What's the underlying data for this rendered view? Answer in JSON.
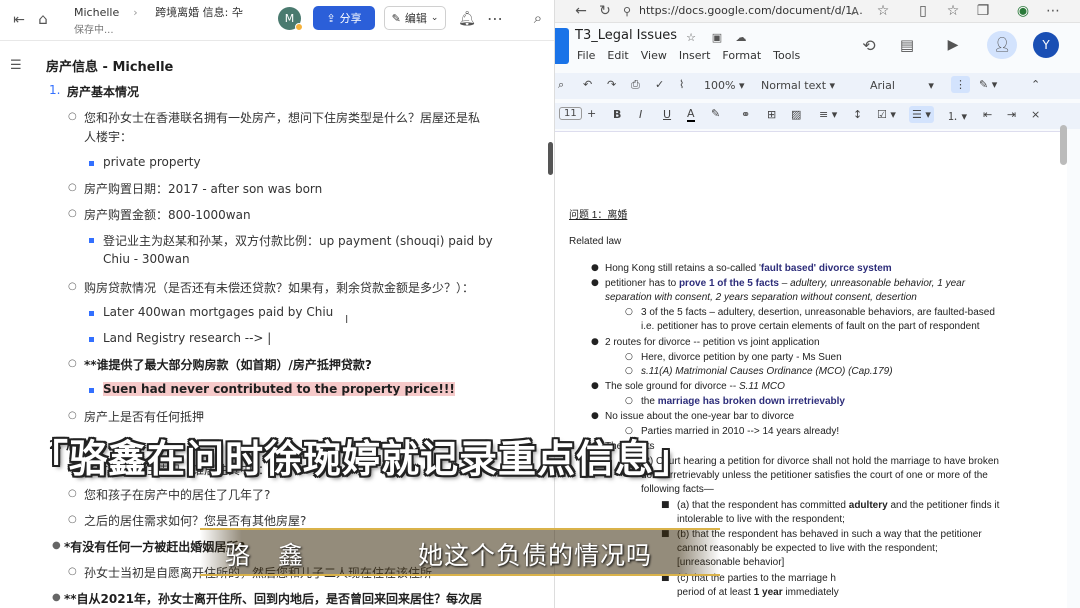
{
  "left_app": {
    "breadcrumb": [
      "Michelle",
      "跨境离婚 信息:  卆"
    ],
    "save_status": "保存中...",
    "avatar_letter": "M",
    "share_label": "分享",
    "edit_label": "编辑",
    "doc_title": "房产信息 - Michelle",
    "section_num": "1.",
    "section_title": "房产基本情况",
    "lines": [
      "您和孙女士在香港联名拥有一处房产，想问下住房类型是什么？居屋还是私",
      "人楼宇：",
      "private property",
      "房产购置日期：2017 - after son was born",
      "房产购置金额：800-1000wan",
      "登记业主为赵某和孙某，双方付款比例：up payment (shouqi) paid by",
      "Chiu - 300wan",
      "购房贷款情况（是否还有未偿还贷款？如果有，剩余贷款金额是多少？）：",
      "Later 400wan mortgages paid by Chiu",
      "Land Registry research --> |",
      "**谁提供了最大部分购房款（如首期）/房产抵押贷款?",
      "Suen had never contributed to the property price!!!",
      "房产上是否有任何抵押",
      "2. 居住",
      "当时房产居住情况（谁居住其中）：",
      "您和孩子在房产中的居住了几年了?",
      "之后的居住需求如何？您是否有其他房屋?",
      "*有没有任何一方被赶出婚姻居所?",
      "孙女士当初是自愿离开住所的，然后您和儿子二人现在住在该住所",
      "**自从2021年，孙女士离开住所、回到内地后，是否曾回来回来居住？每次居"
    ]
  },
  "right_app": {
    "url": "https://docs.google.com/document/d/1...",
    "doc_title": "T3_Legal Issues",
    "menu": [
      "File",
      "Edit",
      "View",
      "Insert",
      "Format",
      "Tools"
    ],
    "avatar_letter": "Y",
    "zoom": "100%",
    "style": "Normal text",
    "font": "Arial",
    "font_size": "11",
    "heading": "问题 1：离婚",
    "related_law": "Related law",
    "b1_pre": "Hong Kong still retains a so-called '",
    "b1_bold": "fault based' divorce system",
    "b2_pre": "petitioner has to ",
    "b2_bold": "prove 1 of the 5 facts",
    "b2_ital": " – adultery, unreasonable behavior, 1 year",
    "b2_ital2": "separation with consent, 2 years separation without consent, desertion",
    "b2_sub1": "3 of the 5 facts – adultery, desertion, unreasonable behaviors, are faulted-based",
    "b2_sub2": "i.e. petitioner has to prove certain elements of fault on the part of respondent",
    "b3": "2 routes for divorce -- petition vs joint application",
    "b3_sub": "Here, divorce petition by one party - Ms Suen",
    "b3_sub2": "s.11(A) Matrimonial Causes Ordinance (MCO) (Cap.179)",
    "b4_pre": "The sole ground for divorce -- ",
    "b4_ital": "S.11 MCO",
    "b4_sub_pre": "the ",
    "b4_sub_bold": "marriage has broken down irretrievably",
    "b5": "No issue about the one-year bar to divorce",
    "b5_sub": "Parties married in 2010 --> 14 years already!",
    "b6": "The 5 facts",
    "b6_sub1": "(2) Court hearing a petition for divorce shall not hold the marriage to have broken",
    "b6_sub2": "down irretrievably unless the petitioner satisfies the court of one or more of the",
    "b6_sub3": "following facts—",
    "b6_a1_pre": "(a) that the respondent has committed ",
    "b6_a1_bold": "adultery",
    "b6_a1_post": " and the petitioner finds it",
    "b6_a2": "intolerable to live with the respondent;",
    "b6_b1": "(b) that the respondent has behaved in such a way that the petitioner",
    "b6_b2": "cannot reasonably be expected to live with the respondent;",
    "b6_b3": "[unreasonable behavior]",
    "b6_c1": "(c) that the parties to the marriage h",
    "b6_c2_pre": "period of at least ",
    "b6_c2_bold": "1 year",
    "b6_c2_post": " immediately"
  },
  "captions": {
    "top": "「骆鑫在问时徐琬婷就记录重点信息」",
    "speaker": "骆 鑫",
    "line": "她这个负债的情况吗"
  },
  "colors": {
    "share_blue": "#2b5fd9",
    "bullet_blue": "#3370ff",
    "highlight": "#f6c9c9",
    "gold": "#d9b24a"
  }
}
